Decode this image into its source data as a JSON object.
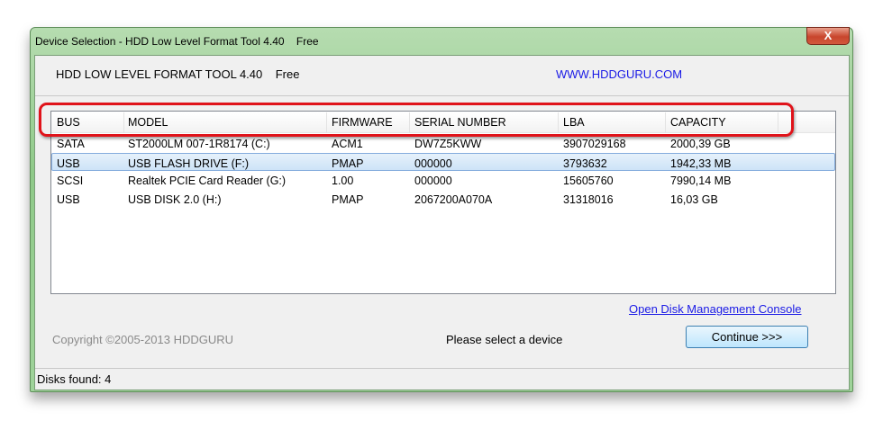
{
  "window": {
    "title": "Device Selection - HDD Low Level Format Tool 4.40    Free",
    "close_label": "X"
  },
  "header": {
    "app_title": "HDD LOW LEVEL FORMAT TOOL 4.40    Free",
    "website": "WWW.HDDGURU.COM"
  },
  "table": {
    "columns": [
      "BUS",
      "MODEL",
      "FIRMWARE",
      "SERIAL NUMBER",
      "LBA",
      "CAPACITY"
    ],
    "rows": [
      [
        "SATA",
        "ST2000LM 007-1R8174 (C:)",
        "ACM1",
        "DW7Z5KWW",
        "3907029168",
        "2000,39 GB"
      ],
      [
        "USB",
        "USB FLASH DRIVE (F:)",
        "PMAP",
        "000000",
        "3793632",
        "1942,33 MB"
      ],
      [
        "SCSI",
        "Realtek PCIE Card Reader (G:)",
        "1.00",
        "000000",
        "15605760",
        "7990,14 MB"
      ],
      [
        "USB",
        "USB DISK 2.0 (H:)",
        "PMAP",
        "2067200A070A",
        "31318016",
        "16,03 GB"
      ]
    ],
    "selected_row": 1
  },
  "footer": {
    "disk_mgmt_link": "Open Disk Management Console",
    "copyright": "Copyright ©2005-2013 HDDGURU",
    "message": "Please select a device",
    "continue_label": "Continue >>>"
  },
  "status": {
    "text": "Disks found: 4"
  },
  "colors": {
    "highlight": "#e0131a",
    "link": "#1a1ae6",
    "title_bar": "#9fd39a"
  }
}
